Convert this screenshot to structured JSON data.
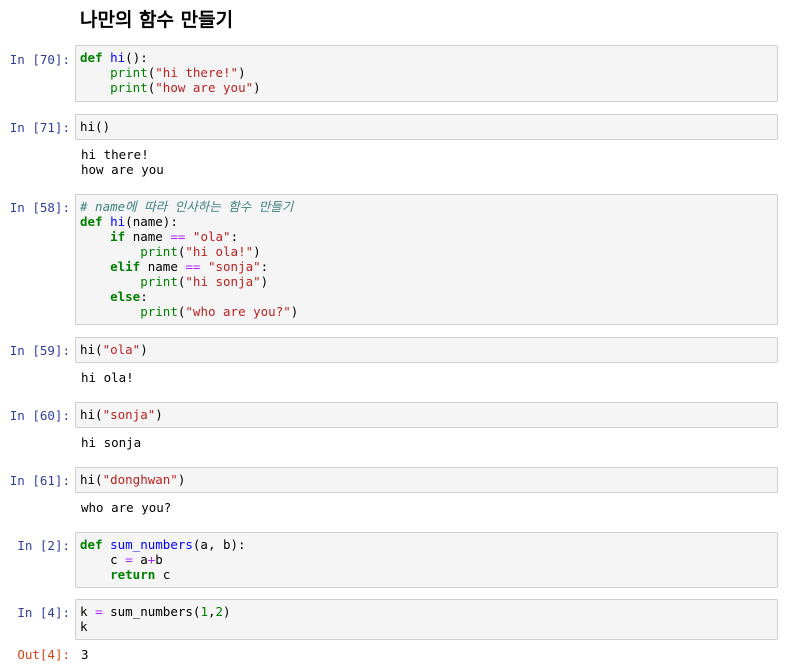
{
  "heading": "나만의 함수 만들기",
  "cells": [
    {
      "prompt": "In [70]:",
      "lines": [
        [
          [
            "kw",
            "def"
          ],
          [
            "t",
            " "
          ],
          [
            "fn",
            "hi"
          ],
          [
            "t",
            "():"
          ]
        ],
        [
          [
            "t",
            "    "
          ],
          [
            "bi",
            "print"
          ],
          [
            "t",
            "("
          ],
          [
            "str",
            "\"hi there!\""
          ],
          [
            "t",
            ")"
          ]
        ],
        [
          [
            "t",
            "    "
          ],
          [
            "bi",
            "print"
          ],
          [
            "t",
            "("
          ],
          [
            "str",
            "\"how are you\""
          ],
          [
            "t",
            ")"
          ]
        ]
      ]
    },
    {
      "prompt": "In [71]:",
      "lines": [
        [
          [
            "t",
            "hi()"
          ]
        ]
      ],
      "output": "hi there!\nhow are you"
    },
    {
      "prompt": "In [58]:",
      "lines": [
        [
          [
            "cm",
            "# name에 따라 인사하는 함수 만들기"
          ]
        ],
        [
          [
            "kw",
            "def"
          ],
          [
            "t",
            " "
          ],
          [
            "fn",
            "hi"
          ],
          [
            "t",
            "(name):"
          ]
        ],
        [
          [
            "t",
            "    "
          ],
          [
            "kw",
            "if"
          ],
          [
            "t",
            " name "
          ],
          [
            "op",
            "=="
          ],
          [
            "t",
            " "
          ],
          [
            "str",
            "\"ola\""
          ],
          [
            "t",
            ":"
          ]
        ],
        [
          [
            "t",
            "        "
          ],
          [
            "bi",
            "print"
          ],
          [
            "t",
            "("
          ],
          [
            "str",
            "\"hi ola!\""
          ],
          [
            "t",
            ")"
          ]
        ],
        [
          [
            "t",
            "    "
          ],
          [
            "kw",
            "elif"
          ],
          [
            "t",
            " name "
          ],
          [
            "op",
            "=="
          ],
          [
            "t",
            " "
          ],
          [
            "str",
            "\"sonja\""
          ],
          [
            "t",
            ":"
          ]
        ],
        [
          [
            "t",
            "        "
          ],
          [
            "bi",
            "print"
          ],
          [
            "t",
            "("
          ],
          [
            "str",
            "\"hi sonja\""
          ],
          [
            "t",
            ")"
          ]
        ],
        [
          [
            "t",
            "    "
          ],
          [
            "kw",
            "else"
          ],
          [
            "t",
            ":"
          ]
        ],
        [
          [
            "t",
            "        "
          ],
          [
            "bi",
            "print"
          ],
          [
            "t",
            "("
          ],
          [
            "str",
            "\"who are you?\""
          ],
          [
            "t",
            ")"
          ]
        ]
      ]
    },
    {
      "prompt": "In [59]:",
      "lines": [
        [
          [
            "t",
            "hi("
          ],
          [
            "str",
            "\"ola\""
          ],
          [
            "t",
            ")"
          ]
        ]
      ],
      "output": "hi ola!"
    },
    {
      "prompt": "In [60]:",
      "lines": [
        [
          [
            "t",
            "hi("
          ],
          [
            "str",
            "\"sonja\""
          ],
          [
            "t",
            ")"
          ]
        ]
      ],
      "output": "hi sonja"
    },
    {
      "prompt": "In [61]:",
      "lines": [
        [
          [
            "t",
            "hi("
          ],
          [
            "str",
            "\"donghwan\""
          ],
          [
            "t",
            ")"
          ]
        ]
      ],
      "output": "who are you?"
    },
    {
      "prompt": "In [2]:",
      "lines": [
        [
          [
            "kw",
            "def"
          ],
          [
            "t",
            " "
          ],
          [
            "fn",
            "sum_numbers"
          ],
          [
            "t",
            "(a, b):"
          ]
        ],
        [
          [
            "t",
            "    c "
          ],
          [
            "op",
            "="
          ],
          [
            "t",
            " a"
          ],
          [
            "op",
            "+"
          ],
          [
            "t",
            "b"
          ]
        ],
        [
          [
            "t",
            "    "
          ],
          [
            "kw",
            "return"
          ],
          [
            "t",
            " c"
          ]
        ]
      ]
    },
    {
      "prompt": "In [4]:",
      "lines": [
        [
          [
            "t",
            "k "
          ],
          [
            "op",
            "="
          ],
          [
            "t",
            " sum_numbers("
          ],
          [
            "num",
            "1"
          ],
          [
            "t",
            ","
          ],
          [
            "num",
            "2"
          ],
          [
            "t",
            ")"
          ]
        ],
        [
          [
            "t",
            "k"
          ]
        ]
      ],
      "out_prompt": "Out[4]:",
      "output": "3"
    }
  ],
  "colors": {
    "prompt_in": "#303f9f",
    "prompt_out": "#d84315",
    "cell_bg": "#f5f5f5",
    "cell_border": "#cfcfcf"
  }
}
